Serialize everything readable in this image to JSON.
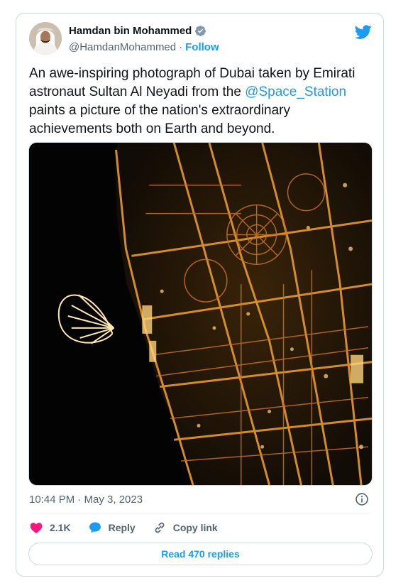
{
  "author": {
    "display_name": "Hamdan bin Mohammed",
    "handle": "@HamdanMohammed",
    "separator": "·",
    "follow_label": "Follow"
  },
  "tweet": {
    "text_before": "An awe-inspiring photograph of Dubai taken by Emirati astronaut Sultan Al Neyadi from the ",
    "mention": "@Space_Station",
    "text_after": " paints a picture of the nation's extraordinary achievements both on Earth and beyond.",
    "timestamp": "10:44 PM · May 3, 2023"
  },
  "actions": {
    "like_count": "2.1K",
    "reply_label": "Reply",
    "copy_link_label": "Copy link"
  },
  "footer": {
    "read_replies_label": "Read 470 replies"
  },
  "colors": {
    "accent": "#1d9bf0",
    "like": "#f91880",
    "secondary_text": "#536471",
    "border": "#cfd9de"
  },
  "icons": {
    "verified": "verified-badge-icon",
    "brand": "twitter-bird-icon",
    "info": "info-icon",
    "like": "heart-icon",
    "reply": "speech-bubble-icon",
    "copy_link": "link-icon"
  }
}
